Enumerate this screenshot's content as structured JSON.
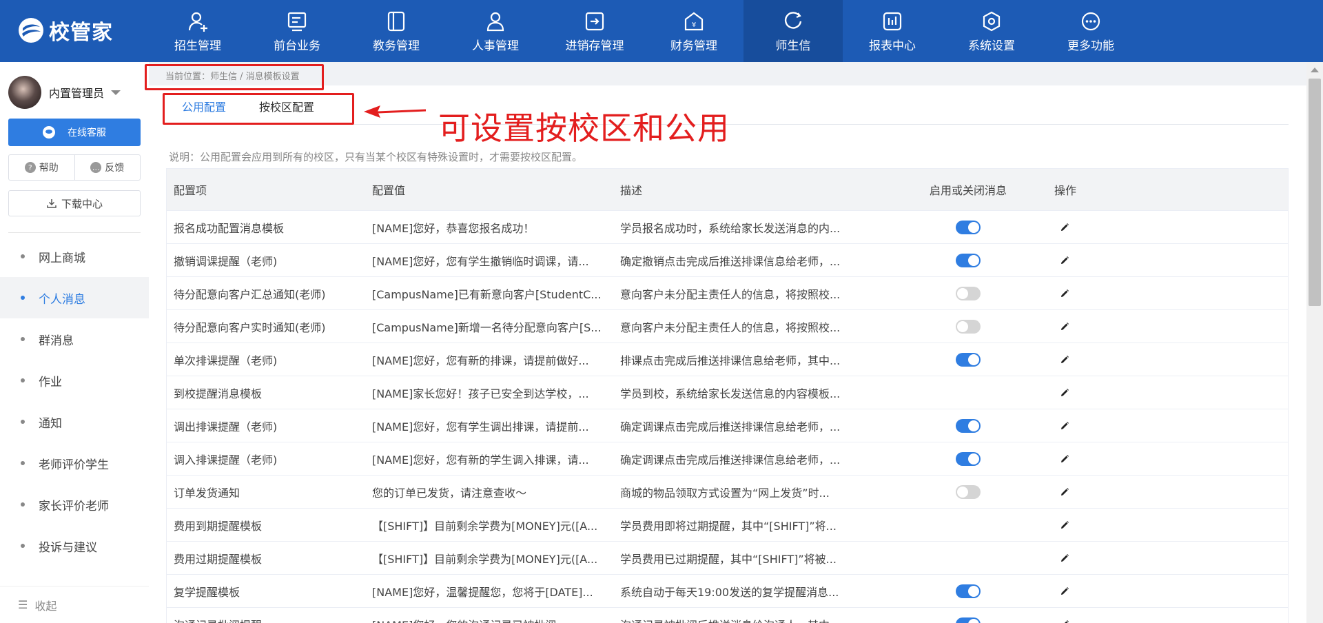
{
  "app": {
    "logo_text": "校管家"
  },
  "nav": [
    {
      "label": "招生管理",
      "icon": "user-add-icon",
      "active": false
    },
    {
      "label": "前台业务",
      "icon": "monitor-icon",
      "active": false
    },
    {
      "label": "教务管理",
      "icon": "book-icon",
      "active": false
    },
    {
      "label": "人事管理",
      "icon": "person-icon",
      "active": false
    },
    {
      "label": "进销存管理",
      "icon": "inventory-icon",
      "active": false
    },
    {
      "label": "财务管理",
      "icon": "finance-icon",
      "active": false
    },
    {
      "label": "师生信",
      "icon": "message-icon",
      "active": true
    },
    {
      "label": "报表中心",
      "icon": "report-icon",
      "active": false
    },
    {
      "label": "系统设置",
      "icon": "settings-icon",
      "active": false
    },
    {
      "label": "更多功能",
      "icon": "more-icon",
      "active": false
    }
  ],
  "sidebar": {
    "username": "内置管理员",
    "online_service": "在线客服",
    "help": "帮助",
    "feedback": "反馈",
    "download_center": "下载中心",
    "items": [
      {
        "label": "网上商城",
        "active": false
      },
      {
        "label": "个人消息",
        "active": true
      },
      {
        "label": "群消息",
        "active": false
      },
      {
        "label": "作业",
        "active": false
      },
      {
        "label": "通知",
        "active": false
      },
      {
        "label": "老师评价学生",
        "active": false
      },
      {
        "label": "家长评价老师",
        "active": false
      },
      {
        "label": "投诉与建议",
        "active": false
      }
    ],
    "collapse": "收起"
  },
  "breadcrumb": "当前位置：师生信 / 消息模板设置",
  "tabs": [
    {
      "label": "公用配置",
      "active": true
    },
    {
      "label": "按校区配置",
      "active": false
    }
  ],
  "annotation": "可设置按校区和公用",
  "note": "说明：公用配置会应用到所有的校区，只有当某个校区有特殊设置时，才需要按校区配置。",
  "table": {
    "headers": [
      "配置项",
      "配置值",
      "描述",
      "启用或关闭消息",
      "操作"
    ],
    "rows": [
      {
        "item": "报名成功配置消息模板",
        "value": "[NAME]您好，恭喜您报名成功！",
        "desc": "学员报名成功时，系统给家长发送消息的内...",
        "toggle": "on"
      },
      {
        "item": "撤销调课提醒（老师)",
        "value": "[NAME]您好，您有学生撤销临时调课，请...",
        "desc": "确定撤销点击完成后推送排课信息给老师，...",
        "toggle": "on"
      },
      {
        "item": "待分配意向客户汇总通知(老师)",
        "value": "[CampusName]已有新意向客户[StudentC...",
        "desc": "意向客户未分配主责任人的信息，将按照校...",
        "toggle": "off"
      },
      {
        "item": "待分配意向客户实时通知(老师)",
        "value": "[CampusName]新增一名待分配意向客户[S...",
        "desc": "意向客户未分配主责任人的信息，将按照校...",
        "toggle": "off"
      },
      {
        "item": "单次排课提醒（老师)",
        "value": "[NAME]您好，您有新的排课，请提前做好...",
        "desc": "排课点击完成后推送排课信息给老师，其中...",
        "toggle": "on"
      },
      {
        "item": "到校提醒消息模板",
        "value": "[NAME]家长您好！孩子已安全到达学校，...",
        "desc": "学员到校，系统给家长发送信息的内容模板...",
        "toggle": "none"
      },
      {
        "item": "调出排课提醒（老师)",
        "value": "[NAME]您好，您有学生调出排课，请提前...",
        "desc": "确定调课点击完成后推送排课信息给老师，...",
        "toggle": "on"
      },
      {
        "item": "调入排课提醒（老师)",
        "value": "[NAME]您好，您有新的学生调入排课，请...",
        "desc": "确定调课点击完成后推送排课信息给老师，...",
        "toggle": "on"
      },
      {
        "item": "订单发货通知",
        "value": "您的订单已发货，请注意查收～",
        "desc": "商城的物品领取方式设置为“网上发货”时...",
        "toggle": "off"
      },
      {
        "item": "费用到期提醒模板",
        "value": "【[SHIFT]】目前剩余学费为[MONEY]元([A...",
        "desc": "学员费用即将过期提醒，其中“[SHIFT]”将...",
        "toggle": "none"
      },
      {
        "item": "费用过期提醒模板",
        "value": "【[SHIFT]】目前剩余学费为[MONEY]元([A...",
        "desc": "学员费用已过期提醒，其中“[SHIFT]”将被...",
        "toggle": "none"
      },
      {
        "item": "复学提醒模板",
        "value": "[NAME]您好，温馨提醒您，您将于[DATE]...",
        "desc": "系统自动于每天19:00发送的复学提醒消息...",
        "toggle": "on"
      },
      {
        "item": "沟通记录批阅提醒",
        "value": "[NAME]您好，您的沟通记录已被批阅...",
        "desc": "沟通记录被批阅后推送消息给沟通人，其中...",
        "toggle": "on"
      }
    ]
  },
  "colors": {
    "nav_bg": "#1d5bb5",
    "accent": "#2f7de1",
    "annotation_red": "#e31e1e"
  }
}
